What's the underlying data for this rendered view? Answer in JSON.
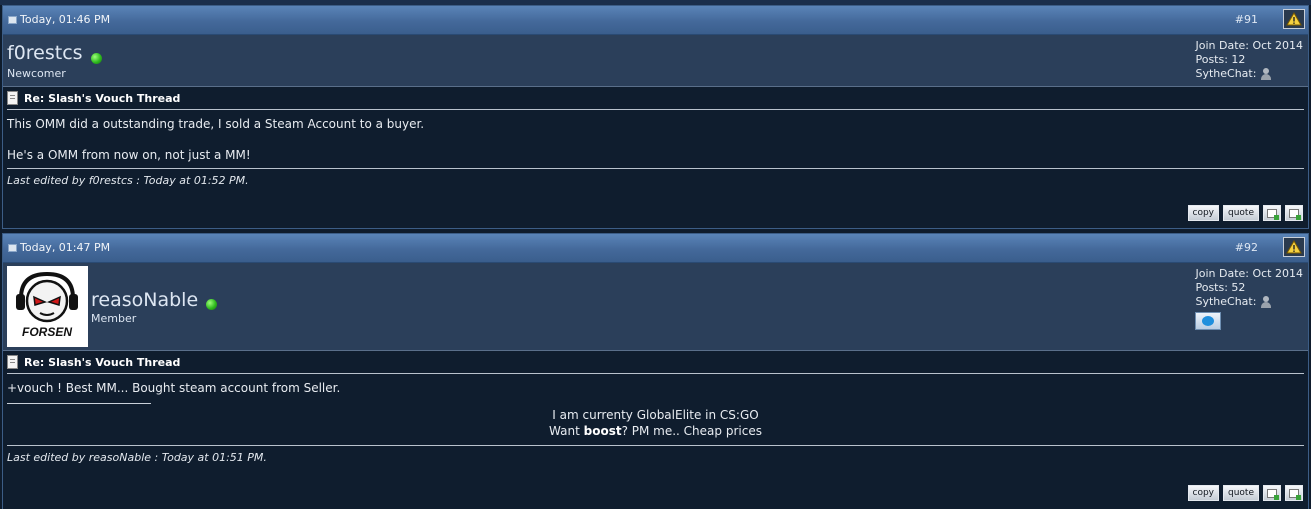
{
  "posts": [
    {
      "date": "Today, 01:46 PM",
      "number": "#91",
      "username": "f0restcs",
      "usertitle": "Newcomer",
      "join_date": "Join Date: Oct 2014",
      "posts_count": "Posts: 12",
      "sythechat_label": "SytheChat:",
      "subject": "Re: Slash's Vouch Thread",
      "body_lines": [
        "This OMM did a outstanding trade, I sold a Steam Account to a buyer.",
        "He's a OMM from now on, not just a MM!"
      ],
      "edited": "Last edited by f0restcs : Today at 01:52 PM.",
      "actions": {
        "copy": "copy",
        "quote": "quote"
      }
    },
    {
      "date": "Today, 01:47 PM",
      "number": "#92",
      "username": "reasoNable",
      "usertitle": "Member",
      "avatar_text": "FORSEN",
      "join_date": "Join Date: Oct 2014",
      "posts_count": "Posts: 52",
      "sythechat_label": "SytheChat:",
      "subject": "Re: Slash's Vouch Thread",
      "body_lines": [
        "+vouch ! Best MM... Bought steam account from Seller."
      ],
      "signature": {
        "line1": "I am currenty GlobalElite in CS:GO",
        "line2_pre": "Want ",
        "line2_bold": "boost",
        "line2_post": "? PM me.. Cheap prices"
      },
      "edited": "Last edited by reasoNable : Today at 01:51 PM.",
      "actions": {
        "copy": "copy",
        "quote": "quote"
      }
    }
  ],
  "colors": {
    "header_blue": "#4a70a3",
    "userbar": "#2b3f5a",
    "body_bg": "#0f1d2e",
    "online": "#2fba1e"
  }
}
